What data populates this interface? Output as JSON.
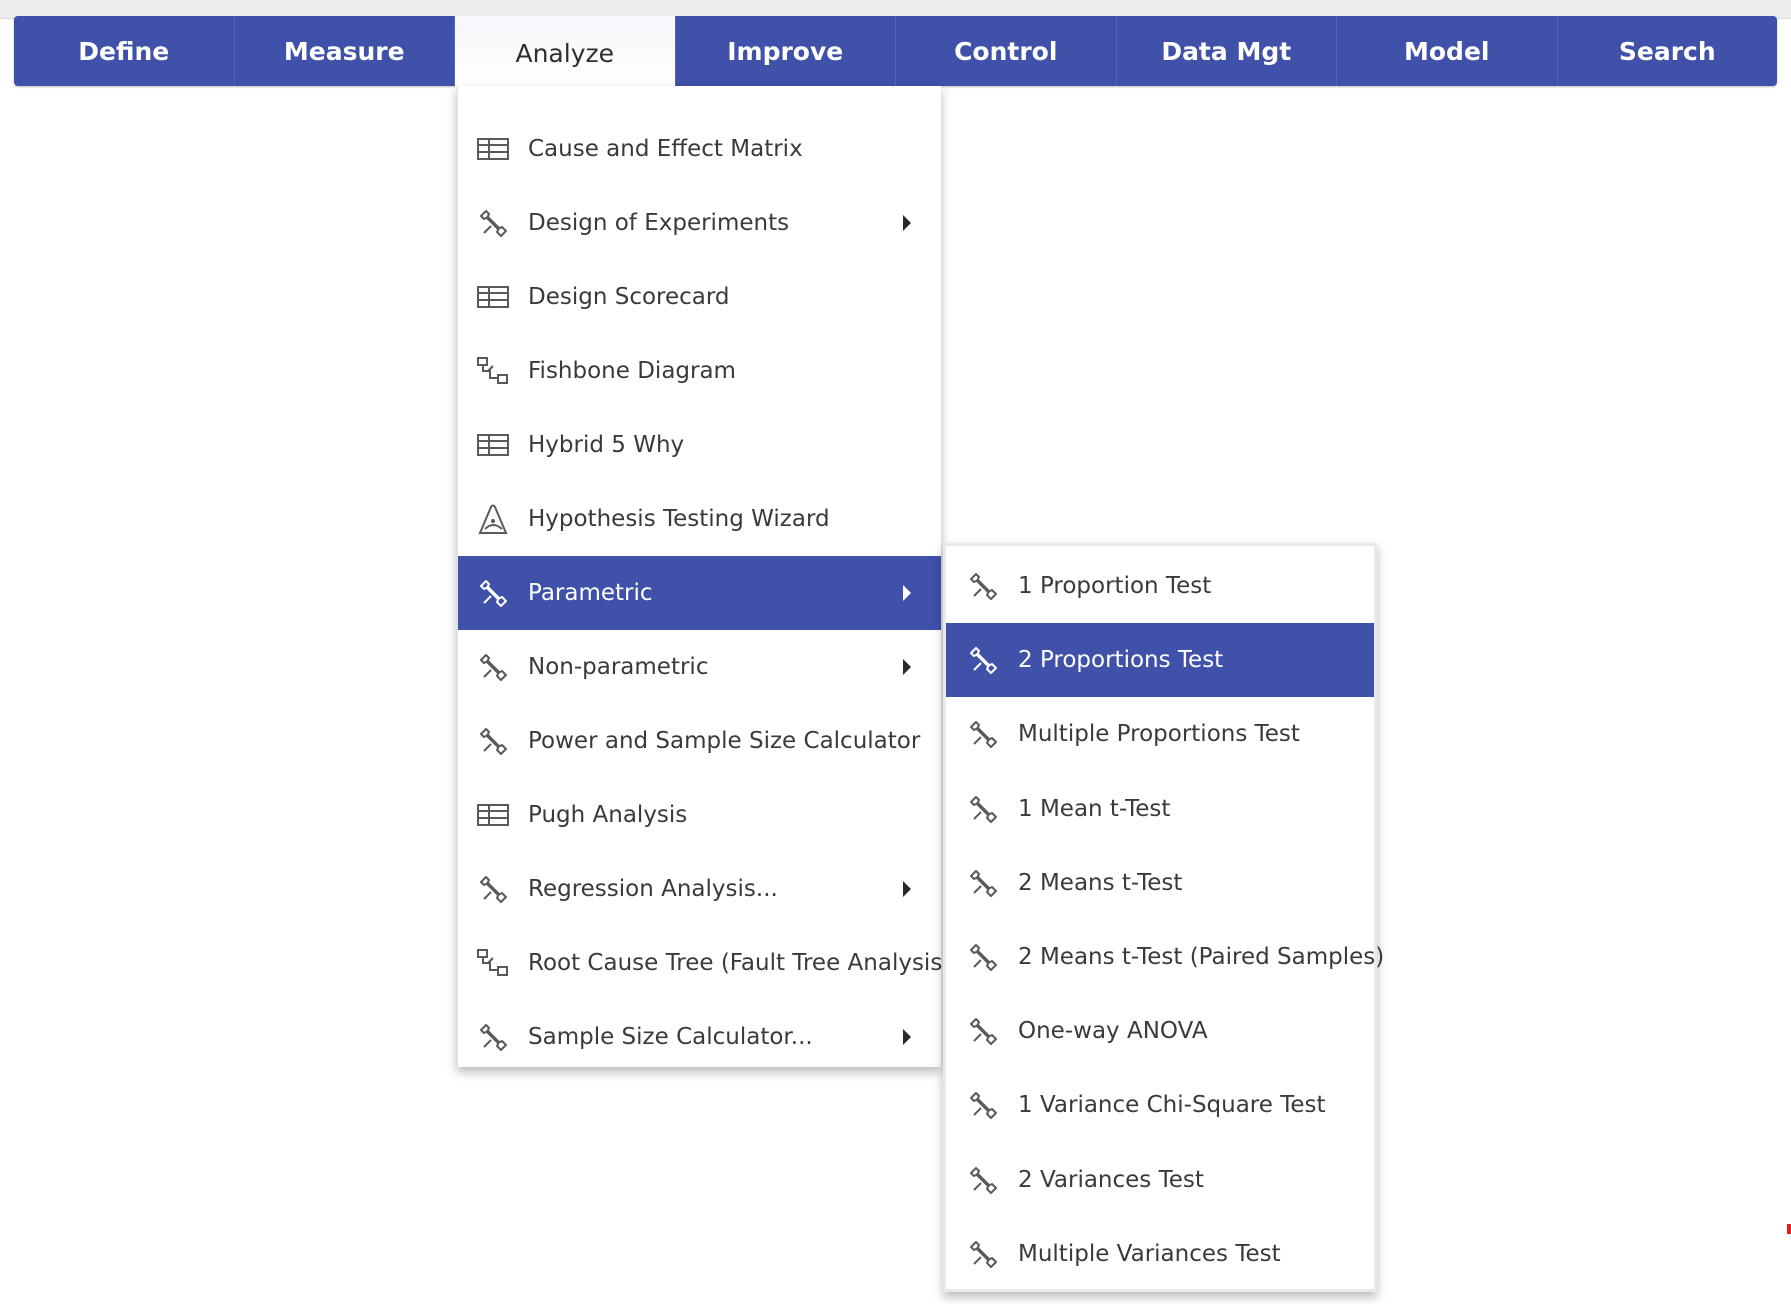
{
  "ribbon": {
    "tabs": [
      {
        "id": "define",
        "label": "Define"
      },
      {
        "id": "measure",
        "label": "Measure"
      },
      {
        "id": "analyze",
        "label": "Analyze",
        "active": true
      },
      {
        "id": "improve",
        "label": "Improve"
      },
      {
        "id": "control",
        "label": "Control"
      },
      {
        "id": "data-mgt",
        "label": "Data Mgt"
      },
      {
        "id": "model",
        "label": "Model"
      },
      {
        "id": "search",
        "label": "Search"
      }
    ]
  },
  "analyze_menu": {
    "items": [
      {
        "label": "Cause and Effect Matrix",
        "icon": "table-icon",
        "submenu": false
      },
      {
        "label": "Design of Experiments",
        "icon": "wrench-icon",
        "submenu": true
      },
      {
        "label": "Design Scorecard",
        "icon": "table-icon",
        "submenu": false
      },
      {
        "label": "Fishbone Diagram",
        "icon": "diagram-icon",
        "submenu": false
      },
      {
        "label": "Hybrid 5 Why",
        "icon": "table-icon",
        "submenu": false
      },
      {
        "label": "Hypothesis Testing Wizard",
        "icon": "wizard-icon",
        "submenu": false
      },
      {
        "label": "Parametric",
        "icon": "wrench-icon",
        "submenu": true,
        "highlighted": true
      },
      {
        "label": "Non-parametric",
        "icon": "wrench-icon",
        "submenu": true
      },
      {
        "label": "Power and Sample Size Calculator",
        "icon": "wrench-icon",
        "submenu": false
      },
      {
        "label": "Pugh Analysis",
        "icon": "table-icon",
        "submenu": false
      },
      {
        "label": "Regression Analysis...",
        "icon": "wrench-icon",
        "submenu": true
      },
      {
        "label": "Root Cause Tree (Fault Tree Analysis)",
        "icon": "diagram-icon",
        "submenu": false
      },
      {
        "label": "Sample Size Calculator...",
        "icon": "wrench-icon",
        "submenu": true
      }
    ]
  },
  "parametric_menu": {
    "items": [
      {
        "label": "1 Proportion Test",
        "icon": "wrench-icon"
      },
      {
        "label": "2 Proportions Test",
        "icon": "wrench-icon",
        "highlighted": true
      },
      {
        "label": "Multiple Proportions Test",
        "icon": "wrench-icon"
      },
      {
        "label": "1 Mean t-Test",
        "icon": "wrench-icon"
      },
      {
        "label": "2 Means t-Test",
        "icon": "wrench-icon"
      },
      {
        "label": "2 Means t-Test (Paired Samples)",
        "icon": "wrench-icon"
      },
      {
        "label": "One-way ANOVA",
        "icon": "wrench-icon"
      },
      {
        "label": "1 Variance Chi-Square Test",
        "icon": "wrench-icon"
      },
      {
        "label": "2 Variances Test",
        "icon": "wrench-icon"
      },
      {
        "label": "Multiple Variances Test",
        "icon": "wrench-icon"
      }
    ]
  },
  "colors": {
    "accent": "#3f51a8",
    "menu_text": "#3a3a3a",
    "highlight_text": "#ffffff"
  }
}
